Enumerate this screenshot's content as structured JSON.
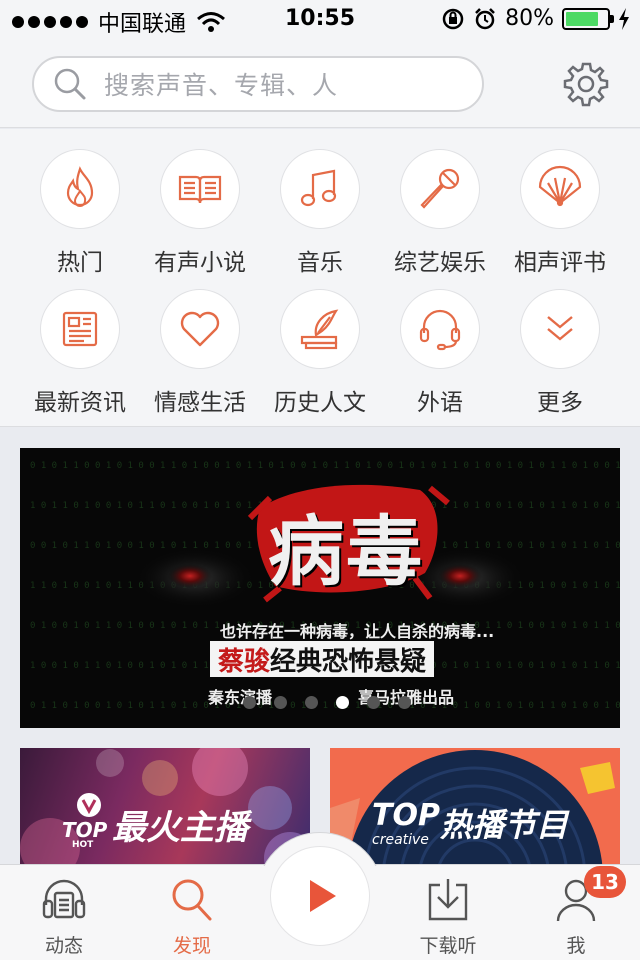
{
  "status_bar": {
    "carrier": "中国联通",
    "time": "10:55",
    "battery_percent": "80%",
    "battery_level": 0.8
  },
  "search": {
    "placeholder": "搜索声音、专辑、人"
  },
  "categories": [
    {
      "label": "热门",
      "icon": "flame-icon"
    },
    {
      "label": "有声小说",
      "icon": "book-icon"
    },
    {
      "label": "音乐",
      "icon": "music-note-icon"
    },
    {
      "label": "综艺娱乐",
      "icon": "microphone-icon"
    },
    {
      "label": "相声评书",
      "icon": "fan-icon"
    },
    {
      "label": "最新资讯",
      "icon": "newspaper-icon"
    },
    {
      "label": "情感生活",
      "icon": "heart-icon"
    },
    {
      "label": "历史人文",
      "icon": "quill-book-icon"
    },
    {
      "label": "外语",
      "icon": "headset-icon"
    },
    {
      "label": "更多",
      "icon": "chevron-double-down-icon"
    }
  ],
  "banner": {
    "title": "病毒",
    "subtitle": "也许存在一种病毒，让人自杀的病毒...",
    "headline_red": "蔡骏",
    "headline": "经典恐怖悬疑",
    "narrator": "秦东演播",
    "producer": "喜马拉雅出品",
    "page_count": 6,
    "active_page": 4
  },
  "cards": [
    {
      "badge": "TOP",
      "badge_sub": "HOT",
      "label": "最火主播"
    },
    {
      "badge": "TOP",
      "badge_sub": "creative",
      "label": "热播节目"
    }
  ],
  "tabbar": {
    "items": [
      {
        "label": "动态",
        "icon": "headphones-icon",
        "active": false
      },
      {
        "label": "发现",
        "icon": "search-icon",
        "active": true
      },
      {
        "label": "下载听",
        "icon": "download-icon",
        "active": false
      },
      {
        "label": "我",
        "icon": "user-icon",
        "active": false
      }
    ],
    "badge_count": "13"
  },
  "colors": {
    "accent": "#e46b47",
    "badge": "#e8553a",
    "banner_red": "#c41a1a"
  }
}
